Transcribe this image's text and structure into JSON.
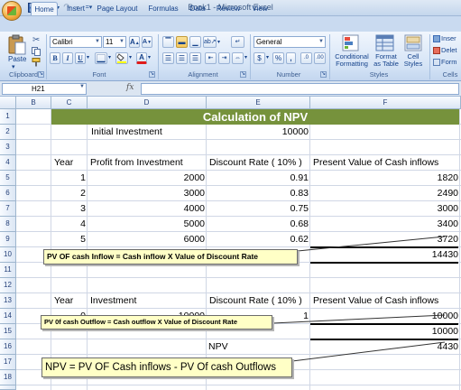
{
  "window": {
    "title": "Book1 - Microsoft Excel"
  },
  "qat": {
    "save_icon": "save-icon",
    "undo_icon": "undo-icon",
    "redo_icon": "redo-icon",
    "customize_icon": "chevron-down-icon"
  },
  "tabs": [
    "Home",
    "Insert",
    "Page Layout",
    "Formulas",
    "Data",
    "Review",
    "View"
  ],
  "ribbon": {
    "clipboard": {
      "label": "Clipboard",
      "paste": "Paste"
    },
    "font": {
      "label": "Font",
      "name": "Calibri",
      "size": "11",
      "bold": "B",
      "italic": "I",
      "underline": "U"
    },
    "alignment": {
      "label": "Alignment"
    },
    "number": {
      "label": "Number",
      "format": "General",
      "currency": "$",
      "percent": "%",
      "comma": ",",
      "inc_decimal": ".0",
      "dec_decimal": ".00"
    },
    "styles": {
      "label": "Styles",
      "conditional": [
        "Conditional",
        "Formatting"
      ],
      "format_table": [
        "Format",
        "as Table"
      ],
      "cell_styles": [
        "Cell",
        "Styles"
      ]
    },
    "cells": {
      "label": "Cells",
      "insert": "Inser",
      "delete": "Delet",
      "format": "Form"
    }
  },
  "formula_bar": {
    "name_box": "H21",
    "fx": "fx",
    "value": ""
  },
  "columns": [
    "B",
    "C",
    "D",
    "E",
    "F"
  ],
  "rows": [
    "1",
    "2",
    "3",
    "4",
    "5",
    "6",
    "7",
    "8",
    "9",
    "10",
    "11",
    "12",
    "13",
    "14",
    "15",
    "16",
    "17",
    "18",
    "19"
  ],
  "sheet": {
    "title": "Calculation of NPV",
    "initial_investment_label": "Initial Investment",
    "initial_investment_value": "10000",
    "header": {
      "year": "Year",
      "profit": "Profit from Investment",
      "rate": "Discount Rate ( 10% )",
      "pv": "Present Value of Cash inflows"
    },
    "data": [
      {
        "year": "1",
        "profit": "2000",
        "rate": "0.91",
        "pv": "1820"
      },
      {
        "year": "2",
        "profit": "3000",
        "rate": "0.83",
        "pv": "2490"
      },
      {
        "year": "3",
        "profit": "4000",
        "rate": "0.75",
        "pv": "3000"
      },
      {
        "year": "4",
        "profit": "5000",
        "rate": "0.68",
        "pv": "3400"
      },
      {
        "year": "5",
        "profit": "6000",
        "rate": "0.62",
        "pv": "3720"
      }
    ],
    "pv_total": "14430",
    "note1": "PV OF cash Inflow = Cash inflow X Value of Discount Rate",
    "header2": {
      "year": "Year",
      "investment": "Investment",
      "rate": "Discount Rate ( 10% )",
      "pv": "Present Value of Cash inflows"
    },
    "row14": {
      "year": "0",
      "investment": "10000",
      "rate": "1",
      "pv": "10000"
    },
    "pv_outflow_total": "10000",
    "note2": "PV 0f cash Outflow = Cash outflow X Value of Discount Rate",
    "npv_label": "NPV",
    "npv_value": "4430",
    "note3": "NPV = PV OF Cash inflows - PV Of cash Outflows"
  }
}
